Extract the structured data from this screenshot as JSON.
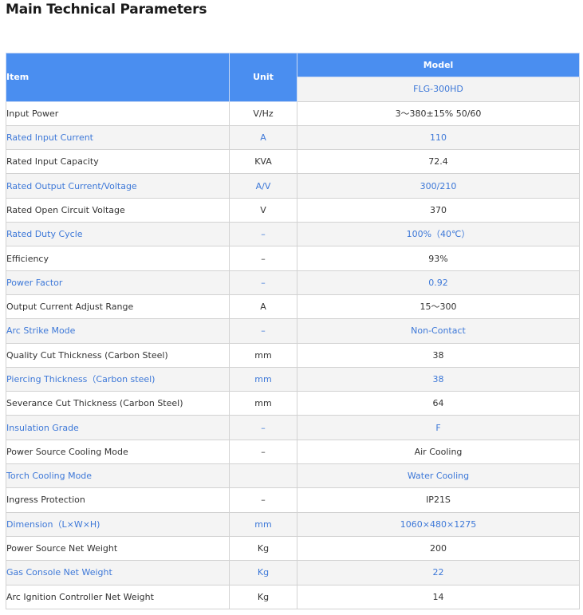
{
  "page": {
    "title": "Main Technical Parameters"
  },
  "table": {
    "headers": {
      "item": "Item",
      "unit": "Unit",
      "model": "Model",
      "model_name": "FLG-300HD"
    },
    "rows": [
      {
        "item": "Input Power",
        "unit": "V/Hz",
        "value": "3～380±15%  50/60"
      },
      {
        "item": "Rated Input Current",
        "unit": "A",
        "value": "110"
      },
      {
        "item": "Rated Input Capacity",
        "unit": "KVA",
        "value": "72.4"
      },
      {
        "item": "Rated Output Current/Voltage",
        "unit": "A/V",
        "value": "300/210"
      },
      {
        "item": "Rated Open Circuit Voltage",
        "unit": "V",
        "value": "370"
      },
      {
        "item": "Rated Duty Cycle",
        "unit": "–",
        "value": "100%（40℃）"
      },
      {
        "item": "Efficiency",
        "unit": "–",
        "value": "93%"
      },
      {
        "item": "Power Factor",
        "unit": "–",
        "value": "0.92"
      },
      {
        "item": "Output Current Adjust Range",
        "unit": "A",
        "value": "15～300"
      },
      {
        "item": "Arc Strike Mode",
        "unit": "–",
        "value": "Non-Contact"
      },
      {
        "item": "Quality Cut Thickness (Carbon Steel)",
        "unit": "mm",
        "value": "38"
      },
      {
        "item": "Piercing Thickness（Carbon steel)",
        "unit": "mm",
        "value": "38"
      },
      {
        "item": "Severance Cut Thickness (Carbon Steel)",
        "unit": "mm",
        "value": "64"
      },
      {
        "item": "Insulation Grade",
        "unit": "–",
        "value": "F"
      },
      {
        "item": "Power Source Cooling Mode",
        "unit": "–",
        "value": "Air Cooling"
      },
      {
        "item": "Torch Cooling Mode",
        "unit": "",
        "value": "Water Cooling"
      },
      {
        "item": "Ingress Protection",
        "unit": "–",
        "value": "IP21S"
      },
      {
        "item": "Dimension（L×W×H)",
        "unit": "mm",
        "value": "1060×480×1275"
      },
      {
        "item": "Power Source Net Weight",
        "unit": "Kg",
        "value": "200"
      },
      {
        "item": "Gas Console Net Weight",
        "unit": "Kg",
        "value": "22"
      },
      {
        "item": "Arc Ignition Controller Net Weight",
        "unit": "Kg",
        "value": "14"
      }
    ]
  },
  "colors": {
    "header_bg": "#4a8ef0",
    "accent_text": "#3d78d8",
    "stripe_bg": "#f4f4f4"
  }
}
